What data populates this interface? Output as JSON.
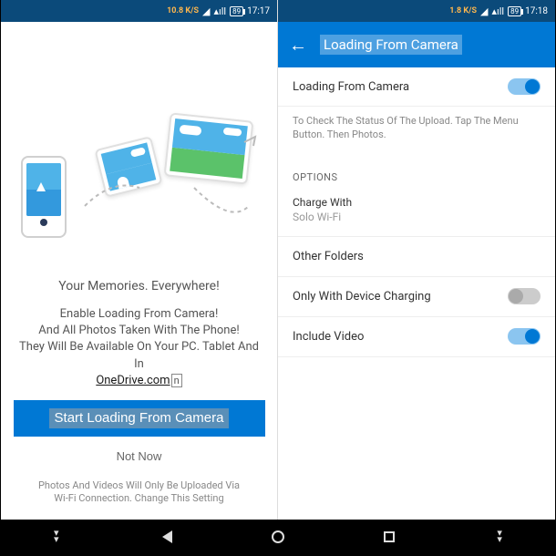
{
  "colors": {
    "primary": "#0078d4",
    "statusbar": "#0b4a7a"
  },
  "status": {
    "speed": "10.8 K/S",
    "speed_right": "1.8 K/S",
    "battery": "89",
    "time_left": "17:17",
    "time_right": "17:18"
  },
  "left": {
    "memories": "Your Memories. Everywhere!",
    "enable_line1": "Enable Loading From Camera!",
    "enable_line2": "And All Photos Taken With The Phone!",
    "enable_line3": "They Will Be Available On Your PC. Tablet And In",
    "onedrive": "OneDrive.com",
    "n_suffix": "n",
    "start_btn": "Start Loading From Camera",
    "not_now": "Not Now",
    "footer1": "Photos And Videos Will Only Be Uploaded Via",
    "footer2": "Wi-Fi Connection. Change This Setting"
  },
  "right": {
    "header_title": "Loading From Camera",
    "main_toggle_label": "Loading From Camera",
    "main_toggle_on": true,
    "status_text": "To Check The Status Of The Upload. Tap The Menu Button. Then Photos.",
    "options_header": "OPTIONS",
    "charge_with_label": "Charge With",
    "charge_with_value": "Solo Wi-Fi",
    "other_folders": "Other Folders",
    "only_charging": "Only With Device Charging",
    "only_charging_on": false,
    "include_video": "Include Video",
    "include_video_on": true
  }
}
